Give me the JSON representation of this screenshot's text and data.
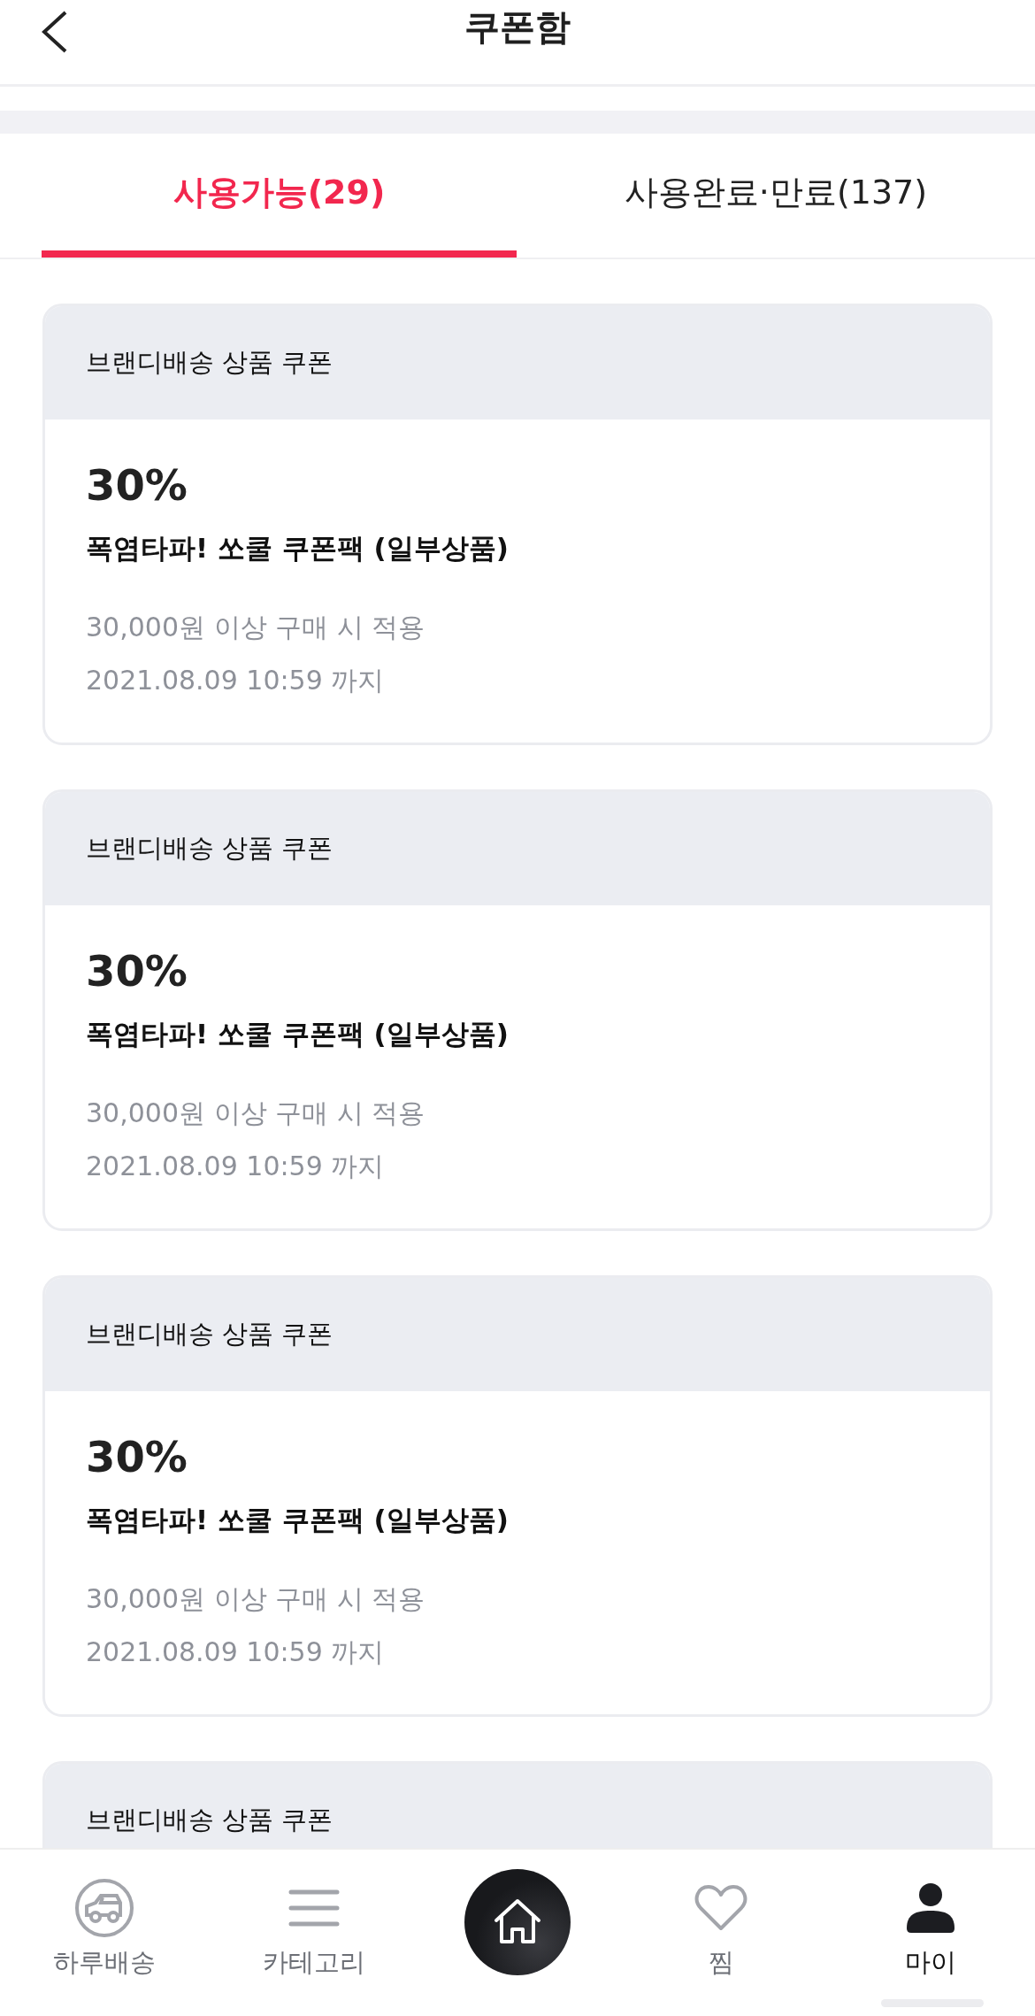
{
  "header": {
    "title": "쿠폰함"
  },
  "tabs": [
    {
      "label": "사용가능(29)",
      "selected": true
    },
    {
      "label": "사용완료·만료(137)",
      "selected": false
    }
  ],
  "coupons": [
    {
      "category": "브랜디배송 상품 쿠폰",
      "discount": "30%",
      "name": "폭염타파! 쏘쿨 쿠폰팩 (일부상품)",
      "condition": "30,000원 이상 구매 시 적용",
      "expiry": "2021.08.09 10:59 까지"
    },
    {
      "category": "브랜디배송 상품 쿠폰",
      "discount": "30%",
      "name": "폭염타파! 쏘쿨 쿠폰팩 (일부상품)",
      "condition": "30,000원 이상 구매 시 적용",
      "expiry": "2021.08.09 10:59 까지"
    },
    {
      "category": "브랜디배송 상품 쿠폰",
      "discount": "30%",
      "name": "폭염타파! 쏘쿨 쿠폰팩 (일부상품)",
      "condition": "30,000원 이상 구매 시 적용",
      "expiry": "2021.08.09 10:59 까지"
    },
    {
      "category": "브랜디배송 상품 쿠폰"
    }
  ],
  "bottom_nav": [
    {
      "kind": "delivery",
      "label": "하루배송",
      "selected": false
    },
    {
      "kind": "menu",
      "label": "카테고리",
      "selected": false
    },
    {
      "kind": "home",
      "selected": false
    },
    {
      "kind": "heart",
      "label": "찜",
      "selected": false
    },
    {
      "kind": "person",
      "label": "마이",
      "selected": true
    }
  ]
}
